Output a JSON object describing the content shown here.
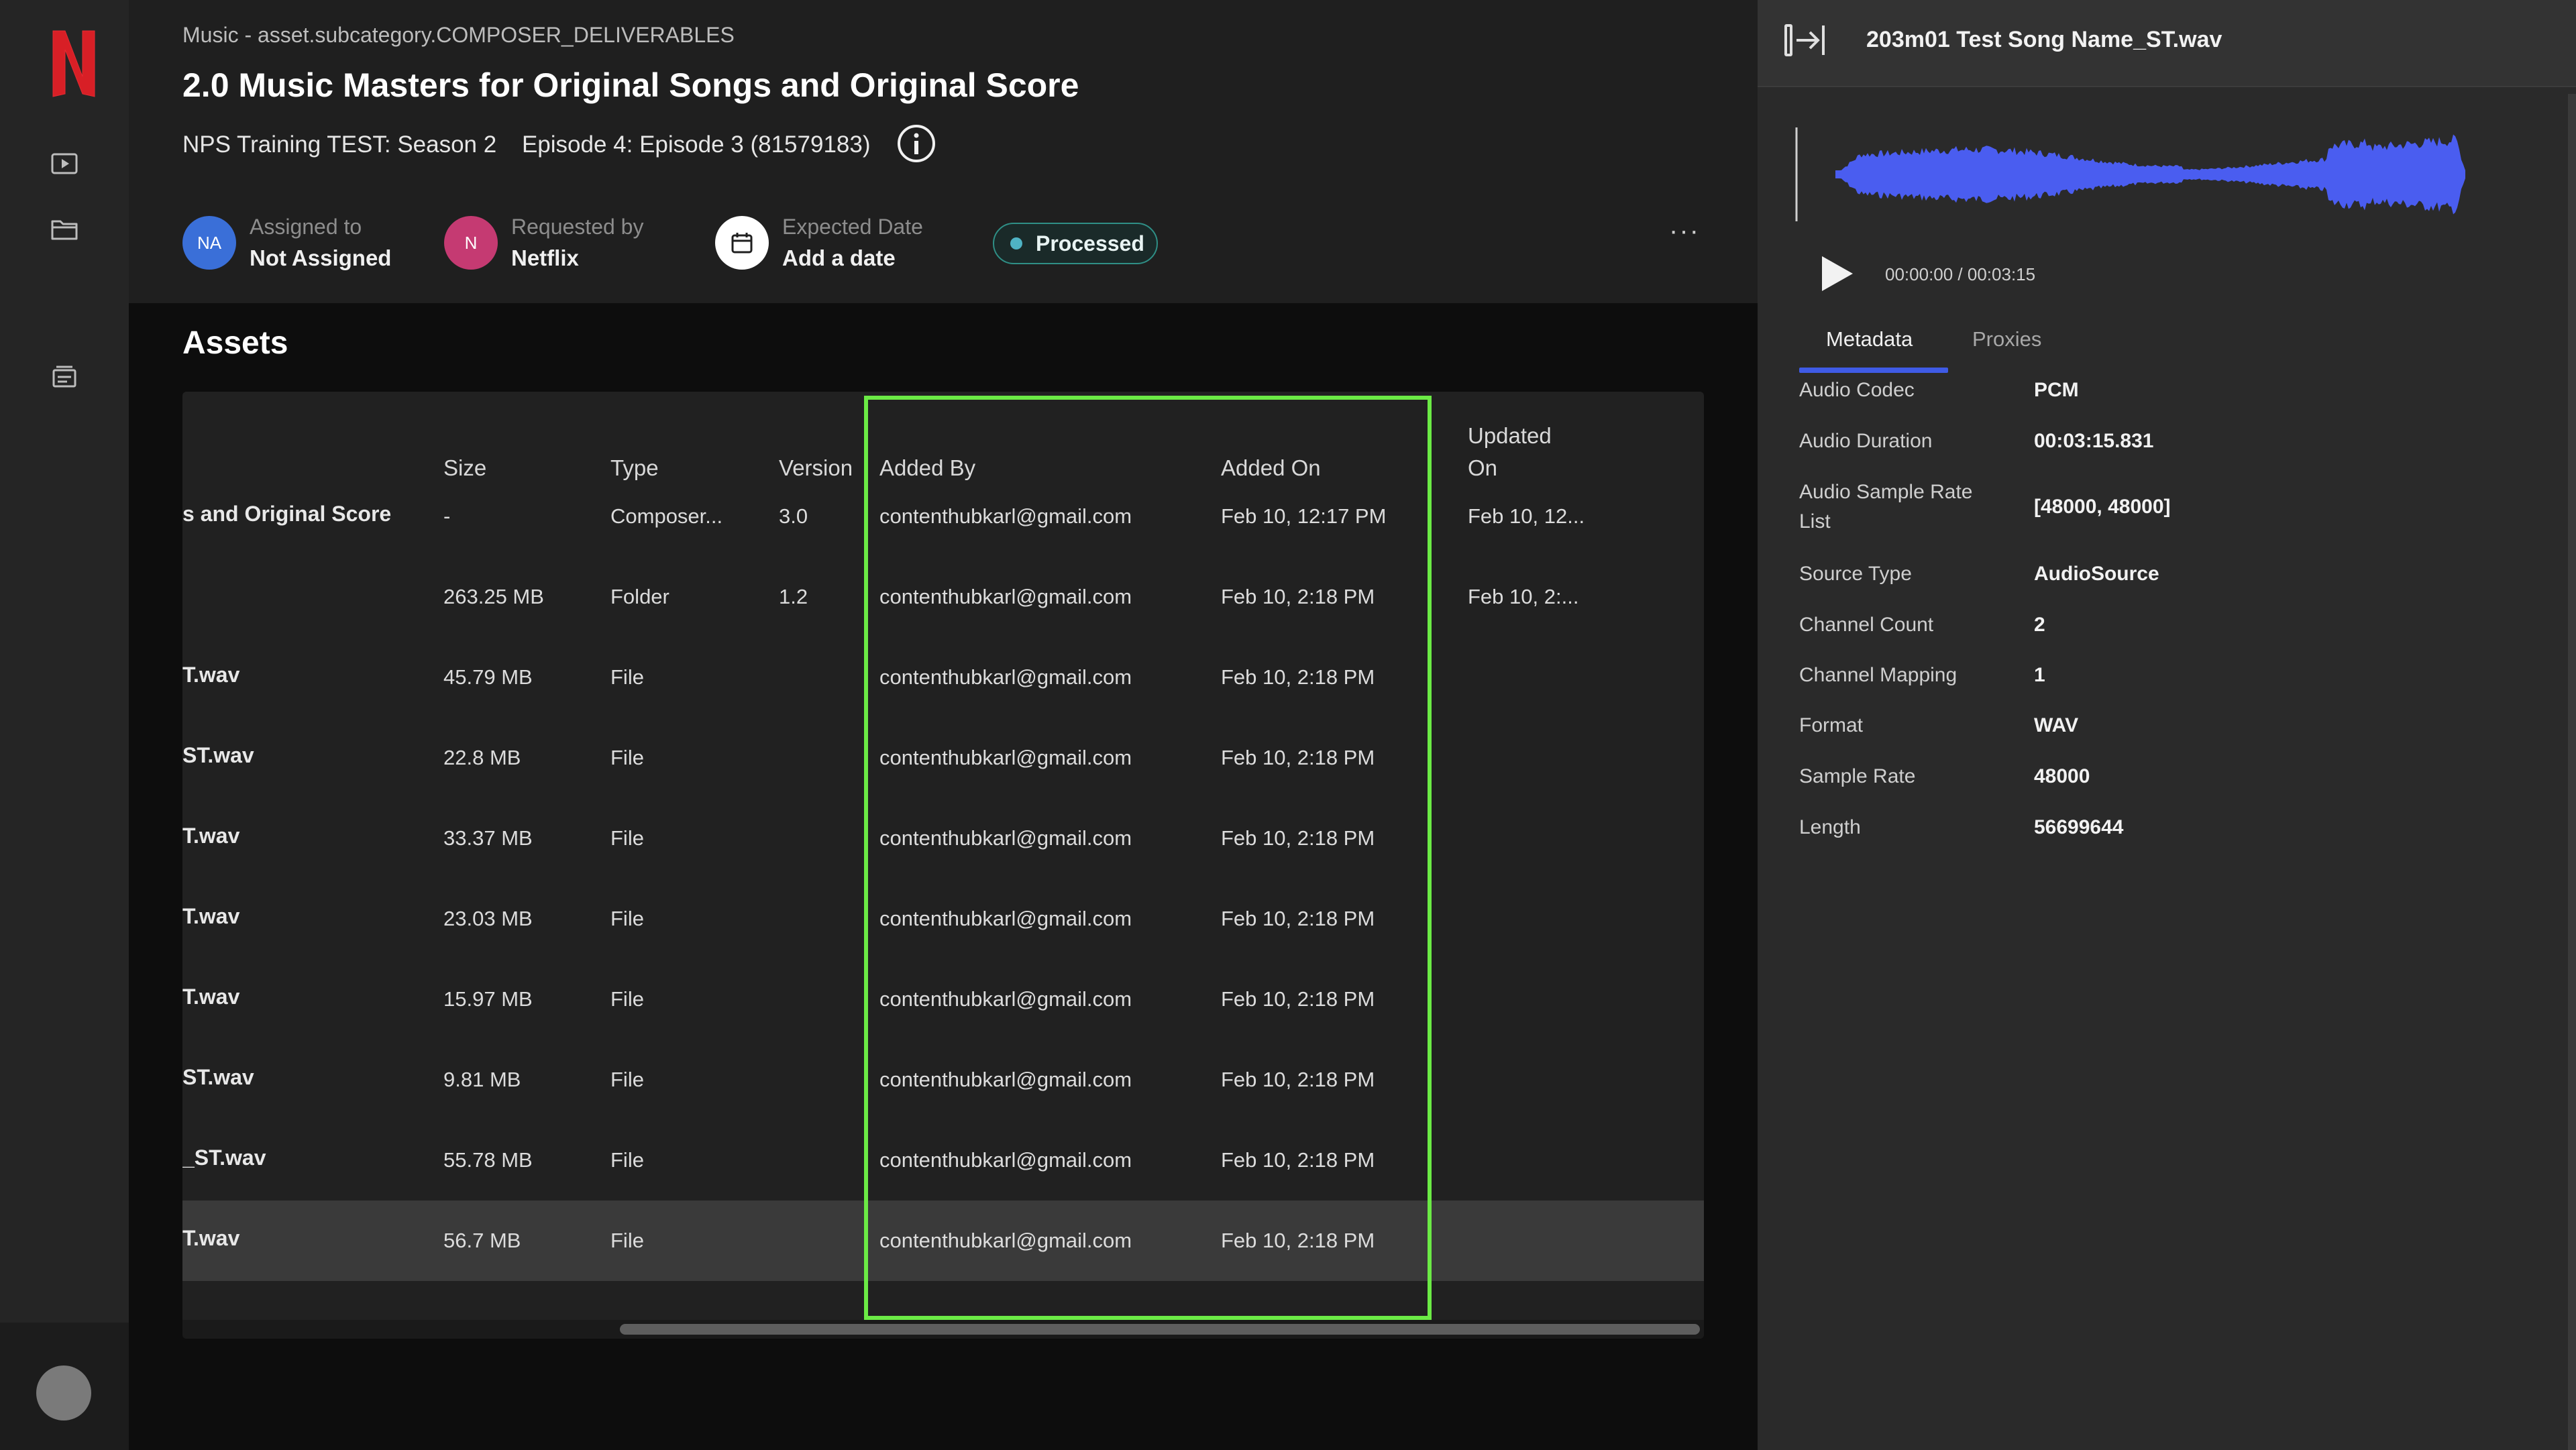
{
  "rail": {
    "logo_letter": "N",
    "icons": [
      "video-icon",
      "folder-icon",
      "inbox-icon"
    ]
  },
  "header": {
    "breadcrumb": "Music - asset.subcategory.COMPOSER_DELIVERABLES",
    "title": "2.0 Music Masters for Original Songs and Original Score",
    "show": "NPS Training TEST: Season 2",
    "episode": "Episode 4: Episode 3 (81579183)",
    "assigned": {
      "label": "Assigned to",
      "initials": "NA",
      "value": "Not Assigned",
      "color": "#3a6fd8"
    },
    "requested": {
      "label": "Requested by",
      "initials": "N",
      "value": "Netflix",
      "color": "#c53a72"
    },
    "expected": {
      "label": "Expected Date",
      "value": "Add a date"
    },
    "status": "Processed",
    "more": "···"
  },
  "assets": {
    "title": "Assets",
    "columns": {
      "size": "Size",
      "type": "Type",
      "version": "Version",
      "added_by": "Added By",
      "added_on": "Added On",
      "updated_on_1": "Updated",
      "updated_on_2": "On"
    },
    "rows": [
      {
        "name": "s and Original Score",
        "size": "-",
        "type": "Composer...",
        "version": "3.0",
        "added_by": "contenthubkarl@gmail.com",
        "added_on": "Feb 10, 12:17 PM",
        "updated_on": "Feb 10, 12..."
      },
      {
        "name": "",
        "size": "263.25 MB",
        "type": "Folder",
        "version": "1.2",
        "added_by": "contenthubkarl@gmail.com",
        "added_on": "Feb 10, 2:18 PM",
        "updated_on": "Feb 10, 2:..."
      },
      {
        "name": "T.wav",
        "size": "45.79 MB",
        "type": "File",
        "version": "",
        "added_by": "contenthubkarl@gmail.com",
        "added_on": "Feb 10, 2:18 PM",
        "updated_on": ""
      },
      {
        "name": "ST.wav",
        "size": "22.8 MB",
        "type": "File",
        "version": "",
        "added_by": "contenthubkarl@gmail.com",
        "added_on": "Feb 10, 2:18 PM",
        "updated_on": ""
      },
      {
        "name": "T.wav",
        "size": "33.37 MB",
        "type": "File",
        "version": "",
        "added_by": "contenthubkarl@gmail.com",
        "added_on": "Feb 10, 2:18 PM",
        "updated_on": ""
      },
      {
        "name": "T.wav",
        "size": "23.03 MB",
        "type": "File",
        "version": "",
        "added_by": "contenthubkarl@gmail.com",
        "added_on": "Feb 10, 2:18 PM",
        "updated_on": ""
      },
      {
        "name": "T.wav",
        "size": "15.97 MB",
        "type": "File",
        "version": "",
        "added_by": "contenthubkarl@gmail.com",
        "added_on": "Feb 10, 2:18 PM",
        "updated_on": ""
      },
      {
        "name": "ST.wav",
        "size": "9.81 MB",
        "type": "File",
        "version": "",
        "added_by": "contenthubkarl@gmail.com",
        "added_on": "Feb 10, 2:18 PM",
        "updated_on": ""
      },
      {
        "name": "_ST.wav",
        "size": "55.78 MB",
        "type": "File",
        "version": "",
        "added_by": "contenthubkarl@gmail.com",
        "added_on": "Feb 10, 2:18 PM",
        "updated_on": ""
      },
      {
        "name": "T.wav",
        "size": "56.7 MB",
        "type": "File",
        "version": "",
        "added_by": "contenthubkarl@gmail.com",
        "added_on": "Feb 10, 2:18 PM",
        "updated_on": ""
      }
    ],
    "highlight_color": "#6bea45"
  },
  "panel": {
    "title": "203m01 Test Song Name_ST.wav",
    "time": "00:00:00 / 00:03:15",
    "waveform_color": "#4a5df0",
    "tabs": {
      "metadata": "Metadata",
      "proxies": "Proxies"
    },
    "metadata": [
      {
        "label": "Audio Codec",
        "value": "PCM"
      },
      {
        "label": "Audio Duration",
        "value": "00:03:15.831"
      },
      {
        "label": "Audio Sample Rate",
        "label2": "List",
        "value": "[48000, 48000]"
      },
      {
        "label": "Source Type",
        "value": "AudioSource"
      },
      {
        "label": "Channel Count",
        "value": "2"
      },
      {
        "label": "Channel Mapping",
        "value": "1"
      },
      {
        "label": "Format",
        "value": "WAV"
      },
      {
        "label": "Sample Rate",
        "value": "48000"
      },
      {
        "label": "Length",
        "value": "56699644"
      }
    ]
  }
}
